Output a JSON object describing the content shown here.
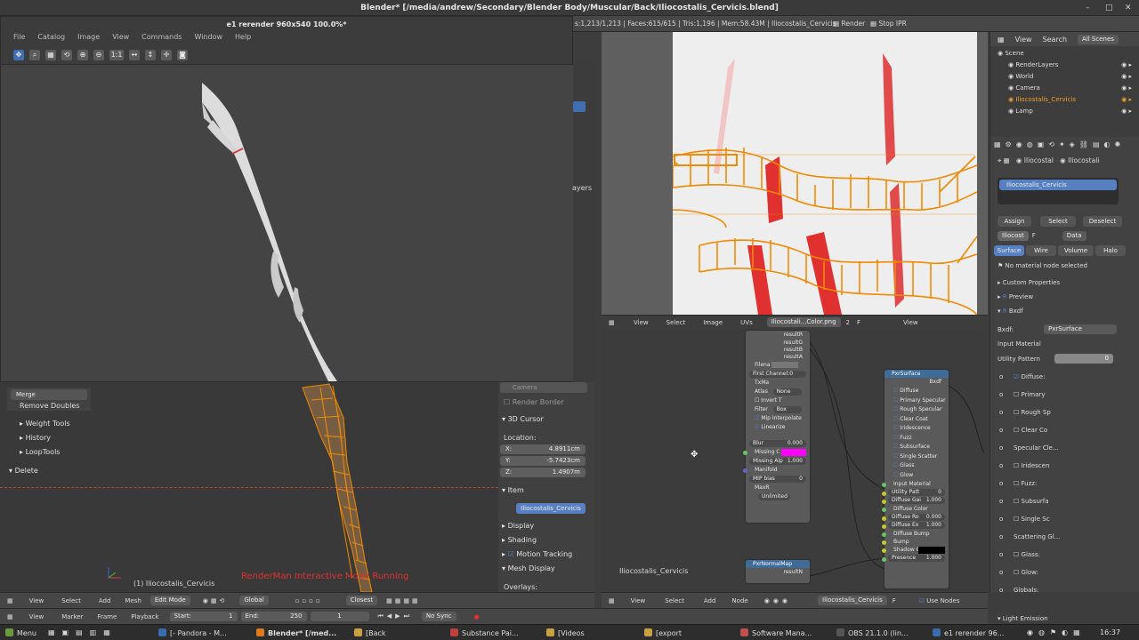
{
  "window_title": "Blender* [/media/andrew/Secondary/Blender Body/Muscular/Back/Iliocostalis_Cervicis.blend]",
  "window_controls": [
    "–",
    "□",
    "✕"
  ],
  "info_bar": {
    "stats": "s:1,213/1,213 | Faces:615/615 | Tris:1,196 | Mem:58.43M | Iliocostalis_Cervicis",
    "render_btn": "Render",
    "stop_ipr_btn": "Stop IPR"
  },
  "render_window": {
    "title": "e1 rerender 960x540 100.0%*",
    "menu": [
      "File",
      "Catalog",
      "Image",
      "View",
      "Commands",
      "Window",
      "Help"
    ],
    "zoom_label": "1:1"
  },
  "viewport3d": {
    "tool_items": [
      "Merge",
      "Remove Doubles"
    ],
    "panels": [
      "Weight Tools",
      "History",
      "LoopTools"
    ],
    "delete_label": "Delete",
    "object_label": "(1) Iliocostalis_Cervicis",
    "status_overlay": "RenderMan Interactive Mode Running",
    "side_layers_label": "ayers"
  },
  "npanel": {
    "camera_label": "Camera",
    "render_border_label": "Render Border",
    "cursor_section": "3D Cursor",
    "location_label": "Location:",
    "x": "4.8911cm",
    "y": "-5.7423cm",
    "z": "1.4907m",
    "item_section": "Item",
    "item_name": "Iliocostalis_Cervicis",
    "display": "Display",
    "shading": "Shading",
    "motion_tracking": "Motion Tracking",
    "mesh_display": "Mesh Display",
    "overlays": "Overlays:"
  },
  "view3d_header": {
    "view": "View",
    "select": "Select",
    "add": "Add",
    "mesh": "Mesh",
    "mode": "Edit Mode",
    "orientation": "Global",
    "snap": "Closest"
  },
  "timeline_header": {
    "view": "View",
    "marker": "Marker",
    "frame": "Frame",
    "playback": "Playback",
    "start_label": "Start:",
    "start_value": "1",
    "end_label": "End:",
    "end_value": "250",
    "current": "1",
    "sync": "No Sync"
  },
  "uv_header": {
    "view": "View",
    "select": "Select",
    "image": "Image",
    "uvs": "UVs",
    "image_name": "Iliocostali...Color.png",
    "slot": "2",
    "f_label": "F",
    "view2": "View"
  },
  "node_editor": {
    "object_label": "Iliocostalis_Cervicis",
    "texture_node_rows": [
      "resultR",
      "resultG",
      "resultB",
      "resultA"
    ],
    "filename_label": "Filena",
    "first_channel": "First Channel:0",
    "txmake": "TxMa",
    "atlas_label": "Atlas",
    "atlas_value": "None",
    "invert_t": "Invert T",
    "filter_label": "Filter",
    "filter_value": "Box",
    "mip_interpolate": "Mip Interpolate",
    "linearize": "Linearize",
    "blur": "Blur",
    "blur_value": "0.000",
    "missing_color": "Missing C",
    "missing_alpha": "Missing Alp",
    "missing_alpha_value": "1.000",
    "manifold": "Manifold",
    "mip_bias": "MIP bias",
    "mip_bias_value": "0",
    "max_res": "MaxR",
    "max_res_value": "Unlimited",
    "normal_node": "PxrNormalMap",
    "normal_output": "resultN",
    "surface_node": "PxrSurface",
    "surface_output": "Bxdf",
    "surface_rows": [
      "Diffuse",
      "Primary Specular",
      "Rough Specular",
      "Clear Coat",
      "Iridescence",
      "Fuzz",
      "Subsurface",
      "Single Scatter",
      "Glass",
      "Glow"
    ],
    "surface_inputs": [
      {
        "label": "Input Material",
        "value": ""
      },
      {
        "label": "Utility Patt",
        "value": "0"
      },
      {
        "label": "Diffuse Gai",
        "value": "1.000"
      },
      {
        "label": "Diffuse Color",
        "value": ""
      },
      {
        "label": "Diffuse Ro",
        "value": "0.000"
      },
      {
        "label": "Diffuse Ex",
        "value": "1.000"
      },
      {
        "label": "Diffuse Bump",
        "value": ""
      },
      {
        "label": "Bump",
        "value": ""
      },
      {
        "label": "Shadow Color",
        "value": ""
      },
      {
        "label": "Presence",
        "value": "1.000"
      }
    ],
    "missing_color_hex": "#ff00ff"
  },
  "node_header": {
    "view": "View",
    "select": "Select",
    "add": "Add",
    "node": "Node",
    "material_name": "Iliocostalis_Cervicis",
    "f_label": "F",
    "use_nodes": "Use Nodes"
  },
  "outliner": {
    "view": "View",
    "search": "Search",
    "scene_filter": "All Scenes",
    "items": [
      {
        "label": "Scene",
        "selected": false,
        "indent": 0
      },
      {
        "label": "RenderLayers",
        "selected": false,
        "indent": 1
      },
      {
        "label": "World",
        "selected": false,
        "indent": 1
      },
      {
        "label": "Camera",
        "selected": false,
        "indent": 1
      },
      {
        "label": "Iliocostalis_Cervicis",
        "selected": true,
        "indent": 1
      },
      {
        "label": "Lamp",
        "selected": false,
        "indent": 1
      }
    ]
  },
  "properties": {
    "breadcrumb": [
      "Iliocostal",
      "Iliocostali"
    ],
    "material_slot": "Iliocostalis_Cervicis",
    "assign": "Assign",
    "select": "Select",
    "deselect": "Deselect",
    "mat_short": "Iliocost",
    "f_label": "F",
    "data_label": "Data",
    "tabs": [
      "Surface",
      "Wire",
      "Volume",
      "Halo"
    ],
    "no_node": "No material node selected",
    "custom_properties": "Custom Properties",
    "preview": "Preview",
    "bxdf_section": "Bxdf",
    "bxdf_label": "Bxdf:",
    "bxdf_value": "PxrSurface",
    "input_material": "Input Material",
    "utility_pattern": "Utility Pattern",
    "utility_value": "0",
    "lobes": [
      "Diffuse:",
      "Primary",
      "Rough Sp",
      "Clear Co",
      "Specular Cle...",
      "Iridescen",
      "Fuzz:",
      "Subsurfa",
      "Single Sc",
      "Scattering Gl...",
      "Glass:",
      "Glow:",
      "Globals:"
    ],
    "light_emission": "Light Emission"
  },
  "taskbar": {
    "menu": "Menu",
    "tasks": [
      "[- Pandora - M...",
      "Blender* [/med...",
      "[Back",
      "Substance Pai...",
      "[Videos",
      "[export",
      "Software Mana...",
      "OBS 21.1.0 (lin...",
      "e1 rerender 96..."
    ],
    "clock": "16:37"
  },
  "colors": {
    "accent_blue": "#5680c2",
    "selection_orange": "#f0a030",
    "overlay_red": "#e03030"
  }
}
